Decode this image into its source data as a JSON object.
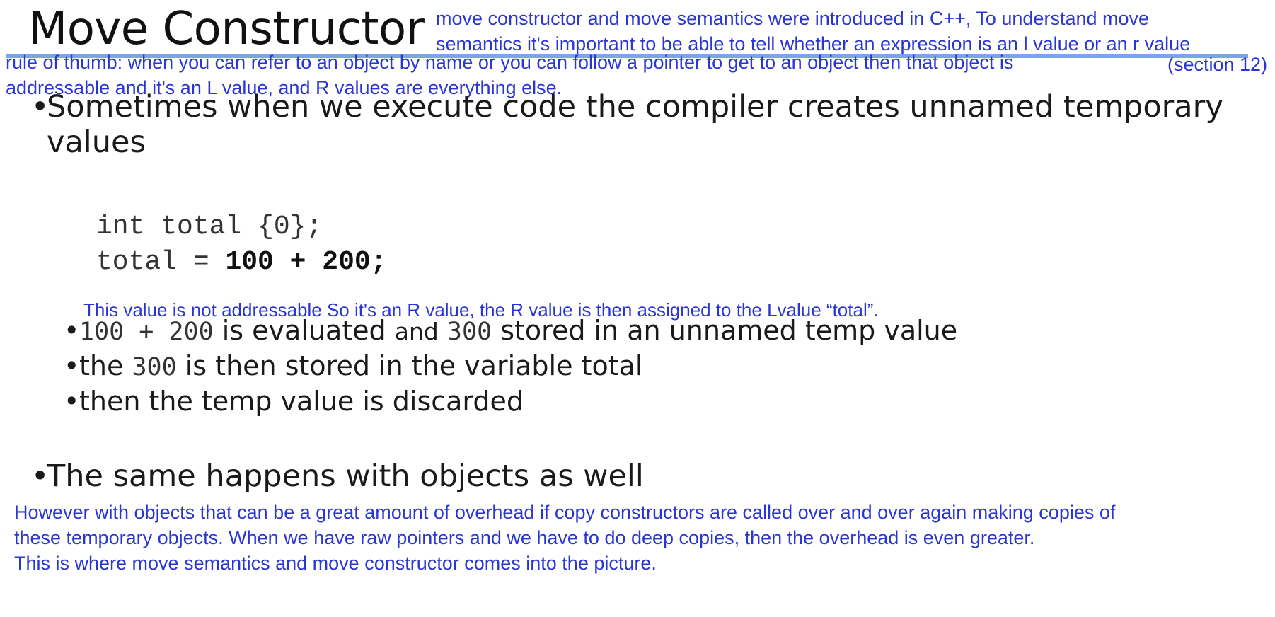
{
  "slide": {
    "title": "Move Constructor",
    "bullets": {
      "b1_line1": "Sometimes when we execute code the compiler creates unnamed temporary",
      "b1_line2": "values",
      "b2": "The same happens with objects as well"
    },
    "code": {
      "line1": "int total {0};",
      "line2_plain": "total = ",
      "line2_bold": "100 + 200;"
    },
    "sub_bullets": {
      "s1_code1": "100 + 200",
      "s1_text1": " is evaluated ",
      "s1_and": "and",
      "s1_code2": "300",
      "s1_text2": " stored in an unnamed temp value",
      "s2_text1": "the ",
      "s2_code": "300",
      "s2_text2": " is then stored in the variable total",
      "s3_text": "then the temp value is discarded"
    }
  },
  "annotations": {
    "intro_line1": "move constructor and move semantics were introduced in C++, To understand move",
    "intro_line2": "semantics it's important to be able to tell whether an expression is an l value or an r value",
    "section": "(section 12)",
    "rule_line1": "rule of thumb: when you can refer to an object by name or you can follow a pointer to get to an object then that object is",
    "rule_line2": "addressable and it's an L value, and R values are everything else.",
    "rvalue_note": "This value is not addressable So it's an R value, the R value is then assigned to the Lvalue “total”.",
    "objects_line1": "However with objects that can be a great amount of overhead if copy constructors are called over and over again making copies of",
    "objects_line2": "these temporary objects. When we have raw pointers and we have to do deep copies, then the overhead is even greater.",
    "objects_line3": "This is where move semantics and move constructor comes into the picture."
  },
  "colors": {
    "annotation_ink": "#2a35d6",
    "highlight": "#5b8de6",
    "slide_text": "#1a1a1a"
  }
}
